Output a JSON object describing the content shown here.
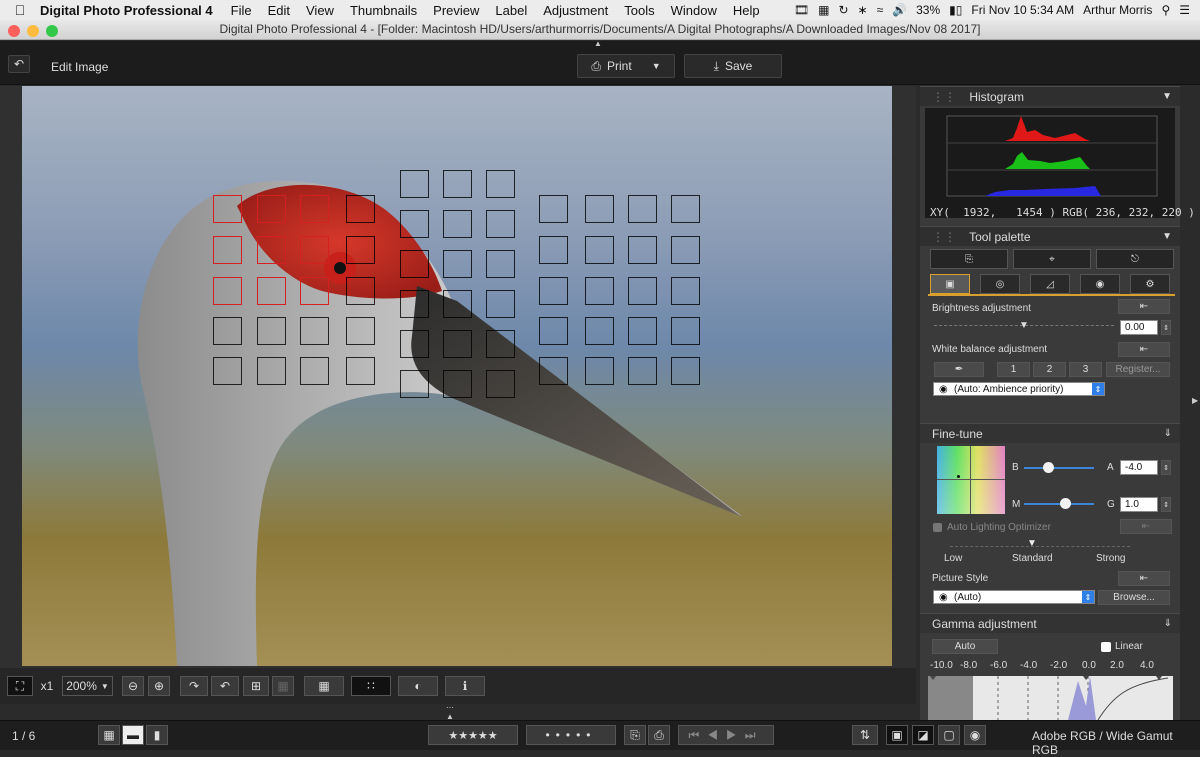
{
  "menubar": {
    "app_name": "Digital Photo Professional 4",
    "items": [
      "File",
      "Edit",
      "View",
      "Thumbnails",
      "Preview",
      "Label",
      "Adjustment",
      "Tools",
      "Window",
      "Help"
    ],
    "battery": "33%",
    "clock": "Fri Nov 10  5:34 AM",
    "user": "Arthur Morris"
  },
  "window": {
    "title": "Digital Photo Professional 4 - [Folder: Macintosh HD/Users/arthurmorris/Documents/A Digital Photographs/A Downloaded Images/Nov 08 2017]"
  },
  "toolbar": {
    "mode_label": "Edit Image",
    "print_label": "Print",
    "save_label": "Save"
  },
  "histogram": {
    "title": "Histogram",
    "readout": "XY(  1932,   1454 ) RGB( 236, 232, 220 )"
  },
  "tool_palette": {
    "title": "Tool palette",
    "brightness": {
      "label": "Brightness adjustment",
      "value": "0.00"
    },
    "white_balance": {
      "label": "White balance adjustment",
      "buttons": [
        "1",
        "2",
        "3"
      ],
      "register_label": "Register...",
      "mode": "(Auto: Ambience priority)"
    }
  },
  "fine_tune": {
    "title": "Fine-tune",
    "b_label": "B",
    "a_label": "A",
    "a_value": "-4.0",
    "m_label": "M",
    "g_label": "G",
    "g_value": "1.0",
    "alo_label": "Auto Lighting Optimizer",
    "alo_levels": [
      "Low",
      "Standard",
      "Strong"
    ],
    "picture_style_label": "Picture Style",
    "picture_style_value": "(Auto)",
    "browse_label": "Browse..."
  },
  "gamma": {
    "title": "Gamma adjustment",
    "auto_label": "Auto",
    "linear_label": "Linear",
    "scale": [
      "-10.0",
      "-8.0",
      "-6.0",
      "-4.0",
      "-2.0",
      "0.0",
      "2.0",
      "4.0"
    ]
  },
  "view_controls": {
    "x1_label": "x1",
    "zoom_value": "200%"
  },
  "status": {
    "page_index": "1 / 6",
    "color_space": "Adobe RGB / Wide Gamut RGB"
  },
  "colors": {
    "accent": "#d9a030",
    "af_point_active": "#d42020"
  }
}
